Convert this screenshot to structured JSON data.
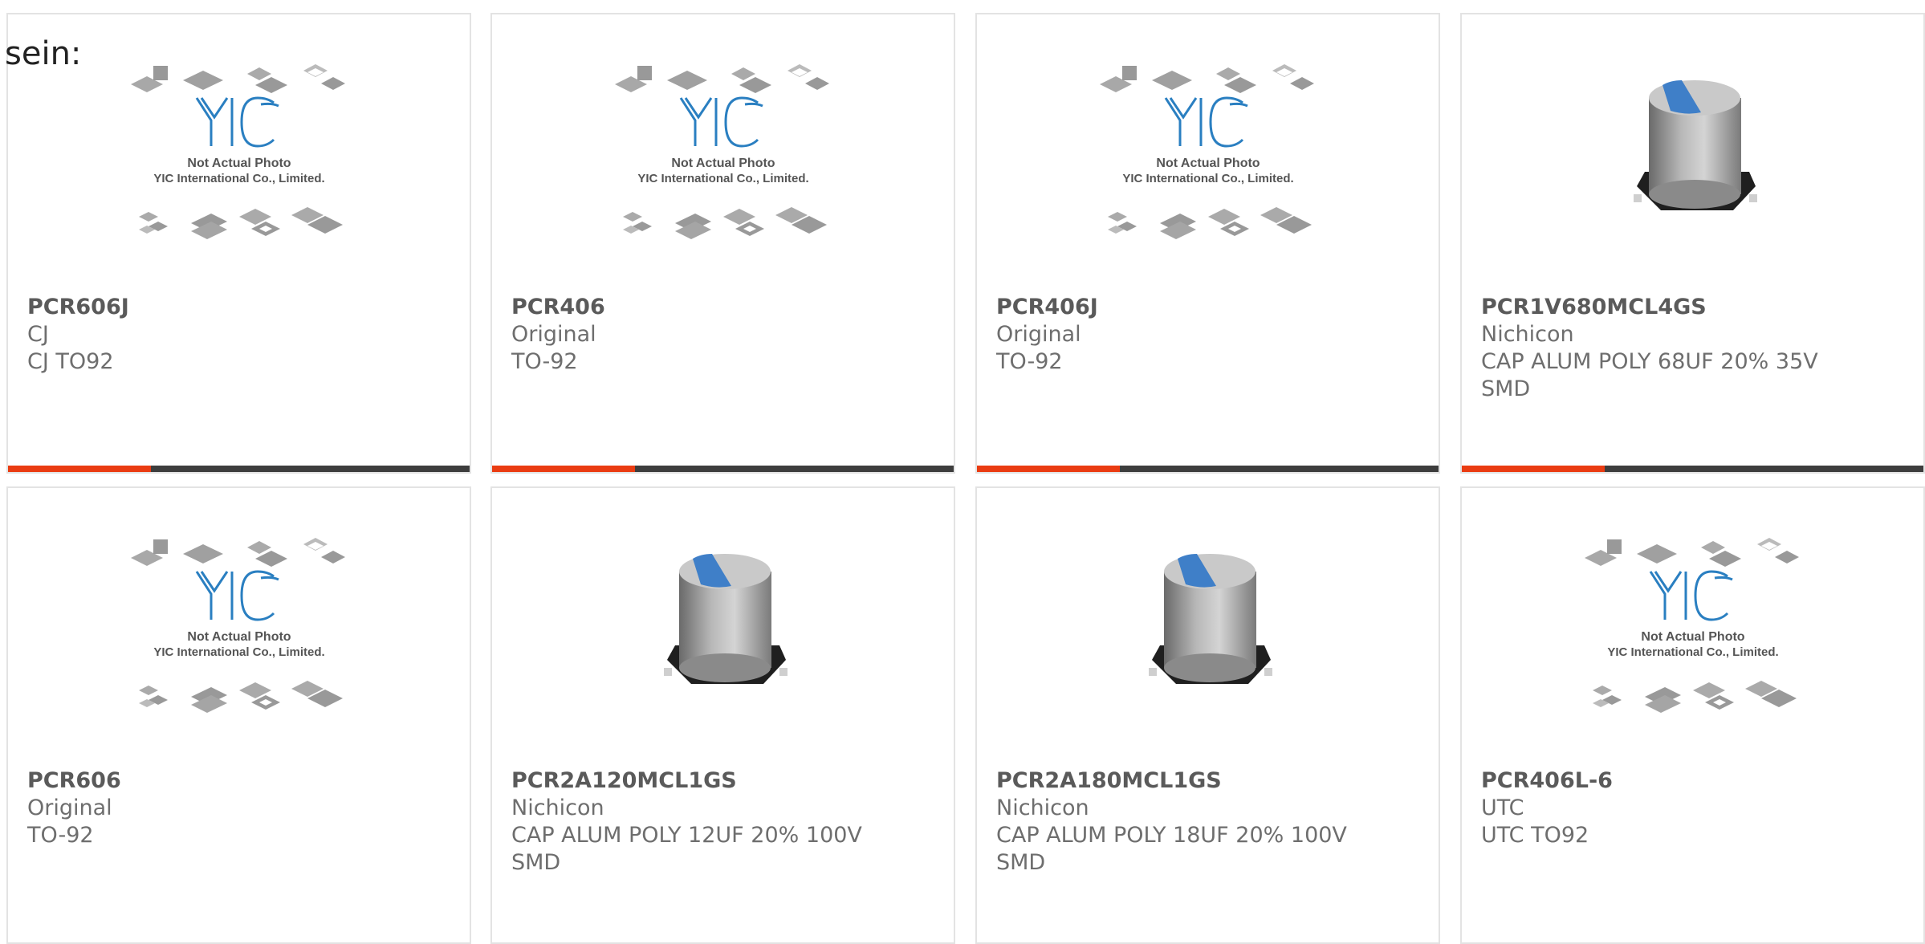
{
  "intro_text": "sein:",
  "placeholder": {
    "caption_line1": "Not Actual Photo",
    "caption_line2": "YIC International Co., Limited.",
    "logo_text": "YIC"
  },
  "products": [
    {
      "part": "PCR606J",
      "brand": "CJ",
      "desc": "CJ TO92",
      "desc2": "",
      "image": "placeholder-image",
      "progress": 0.31
    },
    {
      "part": "PCR406",
      "brand": "Original",
      "desc": "TO-92",
      "desc2": "",
      "image": "placeholder-image",
      "progress": 0.31
    },
    {
      "part": "PCR406J",
      "brand": "Original",
      "desc": "TO-92",
      "desc2": "",
      "image": "placeholder-image",
      "progress": 0.31
    },
    {
      "part": "PCR1V680MCL4GS",
      "brand": "Nichicon",
      "desc": "CAP ALUM POLY 68UF 20% 35V",
      "desc2": "SMD",
      "image": "capacitor-image",
      "progress": 0.31
    },
    {
      "part": "PCR606",
      "brand": "Original",
      "desc": "TO-92",
      "desc2": "",
      "image": "placeholder-image",
      "progress": null
    },
    {
      "part": "PCR2A120MCL1GS",
      "brand": "Nichicon",
      "desc": "CAP ALUM POLY 12UF 20% 100V",
      "desc2": "SMD",
      "image": "capacitor-image",
      "progress": null
    },
    {
      "part": "PCR2A180MCL1GS",
      "brand": "Nichicon",
      "desc": "CAP ALUM POLY 18UF 20% 100V",
      "desc2": "SMD",
      "image": "capacitor-image",
      "progress": null
    },
    {
      "part": "PCR406L-6",
      "brand": "UTC",
      "desc": "UTC TO92",
      "desc2": "",
      "image": "placeholder-image",
      "progress": null
    }
  ],
  "colors": {
    "accent": "#ea3c12",
    "bar": "#3d3d3d",
    "logo_blue": "#2a7fc1",
    "cap_blue": "#3f7fc8"
  }
}
